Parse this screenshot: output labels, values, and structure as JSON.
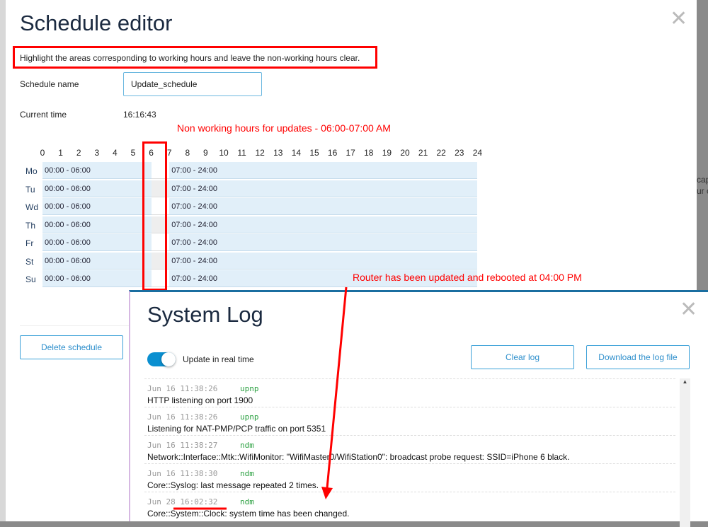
{
  "background": {
    "partial_text": [
      "cap",
      "ur c"
    ]
  },
  "editor": {
    "title": "Schedule editor",
    "instruction": "Highlight the areas corresponding to working hours and leave the non-working hours clear.",
    "name_label": "Schedule name",
    "name_value": "Update_schedule",
    "time_label": "Current time",
    "time_value": "16:16:43",
    "hours": [
      "0",
      "1",
      "2",
      "3",
      "4",
      "5",
      "6",
      "7",
      "8",
      "9",
      "10",
      "11",
      "12",
      "13",
      "14",
      "15",
      "16",
      "17",
      "18",
      "19",
      "20",
      "21",
      "22",
      "23",
      "24"
    ],
    "days": [
      {
        "label": "Mo",
        "ranges": [
          "00:00 - 06:00",
          "07:00 - 24:00"
        ]
      },
      {
        "label": "Tu",
        "ranges": [
          "00:00 - 06:00",
          "07:00 - 24:00"
        ]
      },
      {
        "label": "Wd",
        "ranges": [
          "00:00 - 06:00",
          "07:00 - 24:00"
        ]
      },
      {
        "label": "Th",
        "ranges": [
          "00:00 - 06:00",
          "07:00 - 24:00"
        ]
      },
      {
        "label": "Fr",
        "ranges": [
          "00:00 - 06:00",
          "07:00 - 24:00"
        ]
      },
      {
        "label": "St",
        "ranges": [
          "00:00 - 06:00",
          "07:00 - 24:00"
        ]
      },
      {
        "label": "Su",
        "ranges": [
          "00:00 - 06:00",
          "07:00 - 24:00"
        ]
      }
    ],
    "delete_label": "Delete schedule"
  },
  "annotations": {
    "non_working": "Non working hours for updates - 06:00-07:00 AM",
    "router": "Router has been updated and rebooted at 04:00 PM",
    "color": "#ff0000"
  },
  "log": {
    "title": "System Log",
    "realtime_label": "Update in real time",
    "realtime_on": true,
    "clear_label": "Clear log",
    "download_label": "Download the log file",
    "entries": [
      {
        "time": "Jun 16 11:38:26",
        "source": "upnp",
        "message": "HTTP listening on port 1900"
      },
      {
        "time": "Jun 16 11:38:26",
        "source": "upnp",
        "message": "Listening for NAT-PMP/PCP traffic on port 5351"
      },
      {
        "time": "Jun 16 11:38:27",
        "source": "ndm",
        "message": "Network::Interface::Mtk::WifiMonitor: \"WifiMaster0/WifiStation0\": broadcast probe request: SSID=iPhone 6 black."
      },
      {
        "time": "Jun 16 11:38:30",
        "source": "ndm",
        "message": "Core::Syslog: last message repeated 2 times."
      },
      {
        "time": "Jun 28 16:02:32",
        "source": "ndm",
        "message": "Core::System::Clock: system time has been changed."
      }
    ]
  },
  "colors": {
    "accent": "#2e8fcc",
    "toggle": "#0a8fd0",
    "cell": "#e1eff9"
  }
}
